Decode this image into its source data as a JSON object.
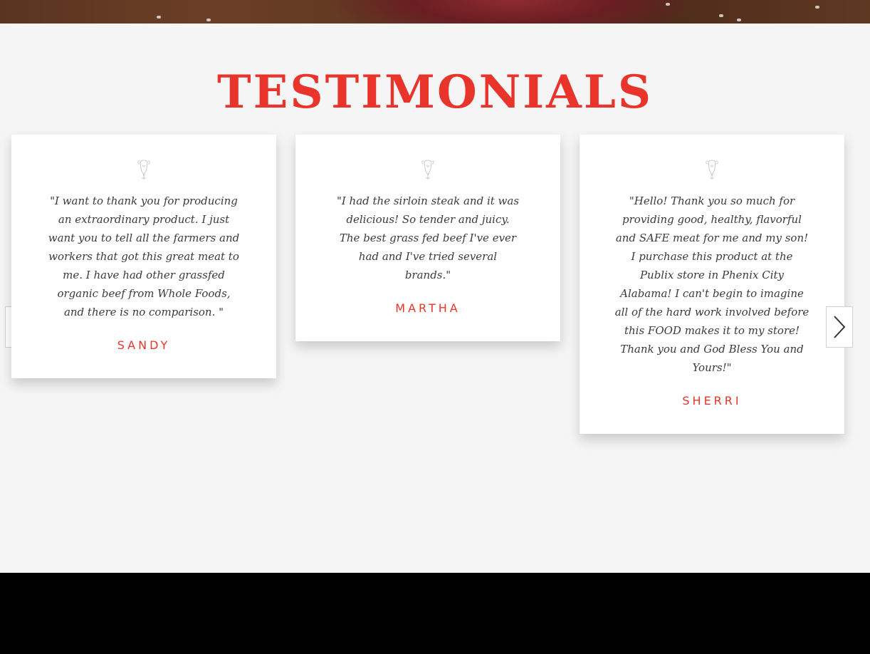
{
  "hero": {
    "image": "raw-beef-steak-photo"
  },
  "section": {
    "title": "TESTIMONIALS"
  },
  "carousel": {
    "prev_icon": "chevron-left-icon",
    "next_icon": "chevron-right-icon"
  },
  "testimonials": [
    {
      "icon": "bison-logo-icon",
      "quote": "\"I want to thank you for producing an extraordinary product. I just want you to tell all the farmers and workers that got this great meat to me. I have had other grassfed organic beef from Whole Foods, and there is no comparison. \"",
      "author": "SANDY"
    },
    {
      "icon": "bison-logo-icon",
      "quote": "\"I had the sirloin steak and it was delicious! So tender and juicy. The best grass fed beef I've ever had and I've tried several brands.\"",
      "author": "MARTHA"
    },
    {
      "icon": "bison-logo-icon",
      "quote": "\"Hello! Thank you so much for providing good, healthy, flavorful and SAFE meat for me and my son!  I purchase this product at the Publix store in Phenix City Alabama!  I can't begin to imagine all of the hard work involved before this FOOD makes it to my store!\nThank you and God Bless You and Yours!\"",
      "author": "SHERRI"
    }
  ],
  "colors": {
    "accent": "#e8342a",
    "background": "#f5f5f5",
    "footer": "#000000",
    "text": "#3b3b3b"
  }
}
